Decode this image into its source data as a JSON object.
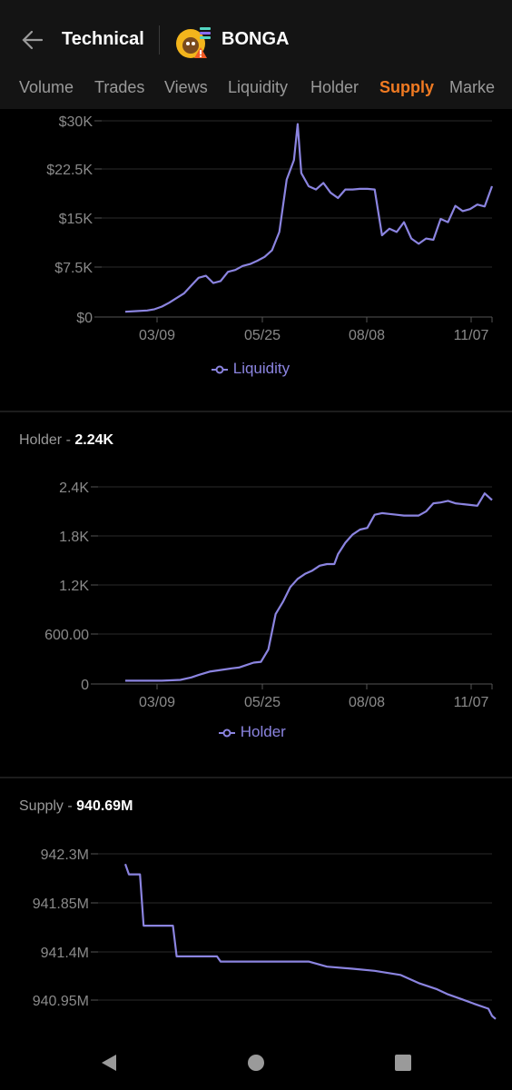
{
  "header": {
    "title": "Technical",
    "token": "BONGA",
    "tabs": [
      {
        "label": "Volume",
        "active": false
      },
      {
        "label": "Trades",
        "active": false
      },
      {
        "label": "Views",
        "active": false
      },
      {
        "label": "Liquidity",
        "active": false
      },
      {
        "label": "Holder",
        "active": false
      },
      {
        "label": "Supply",
        "active": true
      },
      {
        "label": "Marke",
        "active": false
      }
    ]
  },
  "colors": {
    "accent": "#f07a22",
    "line": "#8b84e0",
    "grid": "#2a2a2a",
    "axis": "#8a8a8a"
  },
  "sections": {
    "liquidity": {
      "legend": "Liquidity"
    },
    "holder": {
      "title": "Holder - ",
      "value": "2.24K",
      "legend": "Holder"
    },
    "supply": {
      "title": "Supply - ",
      "value": "940.69M"
    }
  },
  "nav": {
    "back": "back-icon",
    "home": "home-icon",
    "recents": "recents-icon"
  },
  "chart_data": [
    {
      "type": "line",
      "series": [
        {
          "name": "Liquidity"
        }
      ],
      "x_ticks": [
        "03/09",
        "05/25",
        "08/08",
        "11/07"
      ],
      "y_ticks": [
        "$30K",
        "$22.5K",
        "$15K",
        "$7.5K",
        "$0"
      ],
      "ylim": [
        0,
        30000
      ],
      "x": [
        0,
        3,
        6,
        8,
        10,
        12,
        14,
        16,
        18,
        20,
        22,
        24,
        26,
        28,
        30,
        32,
        34,
        36,
        38,
        40,
        42,
        44,
        46,
        47,
        48,
        50,
        52,
        54,
        56,
        58,
        60,
        62,
        64,
        66,
        68,
        70,
        72,
        74,
        76,
        78,
        80,
        82,
        84,
        86,
        88,
        90,
        92,
        94,
        96,
        98,
        100
      ],
      "values": [
        800,
        900,
        1000,
        1200,
        1600,
        2200,
        2900,
        3600,
        4800,
        6000,
        6300,
        5200,
        5500,
        6900,
        7200,
        7800,
        8100,
        8600,
        9200,
        10200,
        13000,
        21000,
        24000,
        29500,
        22000,
        20000,
        19500,
        20500,
        19000,
        18200,
        19500,
        19500,
        19600,
        19600,
        19500,
        12500,
        13500,
        13000,
        14500,
        12000,
        11200,
        12000,
        11800,
        15000,
        14500,
        17000,
        16200,
        16500,
        17200,
        16900,
        20000
      ]
    },
    {
      "type": "line",
      "series": [
        {
          "name": "Holder"
        }
      ],
      "x_ticks": [
        "03/09",
        "05/25",
        "08/08",
        "11/07"
      ],
      "y_ticks": [
        "2.4K",
        "1.8K",
        "1.2K",
        "600.00",
        "0"
      ],
      "ylim": [
        0,
        2400
      ],
      "x": [
        0,
        5,
        10,
        15,
        18,
        20,
        23,
        26,
        29,
        31,
        33,
        35,
        37,
        39,
        41,
        43,
        45,
        47,
        49,
        51,
        53,
        55,
        57,
        58,
        60,
        62,
        64,
        66,
        68,
        70,
        72,
        74,
        76,
        78,
        80,
        82,
        84,
        86,
        88,
        90,
        92,
        94,
        96,
        98,
        100
      ],
      "values": [
        40,
        40,
        40,
        50,
        80,
        110,
        150,
        170,
        190,
        200,
        230,
        260,
        270,
        420,
        850,
        1000,
        1180,
        1280,
        1340,
        1380,
        1440,
        1460,
        1460,
        1580,
        1720,
        1820,
        1880,
        1900,
        2060,
        2080,
        2070,
        2060,
        2050,
        2050,
        2050,
        2100,
        2200,
        2210,
        2230,
        2200,
        2190,
        2180,
        2170,
        2320,
        2240
      ]
    },
    {
      "type": "line",
      "series": [
        {
          "name": "Supply"
        }
      ],
      "y_ticks": [
        "942.3M",
        "941.85M",
        "941.4M",
        "940.95M"
      ],
      "ylim": [
        940.6,
        942.3
      ],
      "x": [
        0,
        1,
        4,
        5,
        13,
        14,
        25,
        26,
        50,
        55,
        62,
        68,
        75,
        80,
        85,
        88,
        92,
        95,
        99,
        100,
        101
      ],
      "values": [
        942.2,
        942.1,
        942.1,
        941.6,
        941.6,
        941.3,
        941.3,
        941.25,
        941.25,
        941.2,
        941.18,
        941.16,
        941.12,
        941.04,
        940.98,
        940.93,
        940.88,
        940.84,
        940.79,
        940.72,
        940.69
      ]
    }
  ]
}
